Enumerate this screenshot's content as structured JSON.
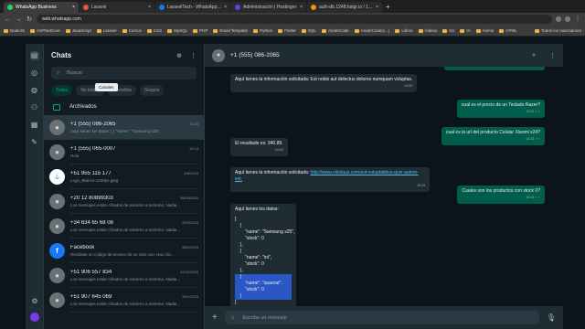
{
  "browser": {
    "tabs": [
      {
        "label": "WhatsApp Business",
        "active": true,
        "color": "#25d366"
      },
      {
        "label": "Laravel",
        "active": false,
        "color": "#f05340"
      },
      {
        "label": "LaravelTech - WhatsApp - Meta",
        "active": false,
        "color": "#1877f2"
      },
      {
        "label": "Administración | Hostinger",
        "active": false,
        "color": "#673de6"
      },
      {
        "label": "auth-db.1248.hstgr.io / 127.0.0",
        "active": false,
        "color": "#f29111"
      }
    ],
    "new_tab": "+",
    "url": "web.whatsapp.com",
    "bookmarks": [
      "NodeJS",
      "ASPNetCore",
      "JavaScript",
      "Laravel",
      "Cursos",
      "CSS",
      "MySQL",
      "PHP",
      "Email Template",
      "Python",
      "Flutter",
      "SQL",
      "AnderCode",
      "AnderCode(c...)",
      "Libros",
      "Videos",
      "Go",
      "IA",
      "Anime",
      "HTML"
    ],
    "all_bookmarks": "Todos los marcadores"
  },
  "chatlist": {
    "title": "Chats",
    "search_placeholder": "Buscar",
    "filters": [
      "Todos",
      "No leídos",
      "Favoritos",
      "Grupos"
    ],
    "tooltip": "Canales",
    "archived_label": "Archivados",
    "chats": [
      {
        "name": "+1 (555) 086-2065",
        "time": "10:24",
        "preview": "Aquí tienes los datos: [ { \"name\": \"Samsung s25\",",
        "active": true,
        "avatar": "person"
      },
      {
        "name": "+1 (555) 065-0007",
        "time": "10:14",
        "preview": "Hola",
        "active": false,
        "avatar": "person"
      },
      {
        "name": "+51 955 115 177",
        "time": "4/6/2024",
        "preview": "Logo_Blanco-1200px.jpeg",
        "active": false,
        "avatar": "logo"
      },
      {
        "name": "+20 12 80899303",
        "time": "06/16/2024",
        "preview": "Los mensajes están cifrados de extremo a extremo. Nadie...",
        "active": false,
        "avatar": "person"
      },
      {
        "name": "+34 634 65 68 08",
        "time": "20/2/2023",
        "preview": "Los mensajes están cifrados de extremo a extremo. Nadie...",
        "active": false,
        "avatar": "person"
      },
      {
        "name": "Facebook",
        "time": "28/2/2023",
        "preview": "Recibiste un código de acceso de un solo uso. Haz clic...",
        "active": false,
        "avatar": "facebook"
      },
      {
        "name": "+51 906 557 834",
        "time": "22/11/2024",
        "preview": "Los mensajes están cifrados de extremo a extremo. Nadie...",
        "active": false,
        "avatar": "person"
      },
      {
        "name": "+51 907 645 069",
        "time": "20/1/2023",
        "preview": "Los mensajes están cifrados de extremo a extremo. Nadie...",
        "active": false,
        "avatar": "person"
      }
    ]
  },
  "conversation": {
    "contact": "+1 (555) 086-2065",
    "composer_placeholder": "Escribe un mensaje",
    "messages": [
      {
        "dir": "in",
        "text": "Aquí tienes la información solicitada: Est nobis aut delectus dolores numquam voluptas.",
        "time": "10:22"
      },
      {
        "dir": "out",
        "text": "cual es el precio de un Teclado Razer?",
        "time": "10:23 ✓✓"
      },
      {
        "dir": "out",
        "text": "cual es la url del producto Celular Xiaomi s24?",
        "time": "10:23 ✓✓"
      },
      {
        "dir": "in",
        "text": "El resultado es: 340.89.",
        "time": "10:23"
      },
      {
        "dir": "in",
        "text": "Aquí tienes la información solicitada:",
        "link": "http://www.nikolaus.com/est-voluptatibus-quis-autem-est.",
        "time": "10:23"
      },
      {
        "dir": "out",
        "text": "Cuales son los productos con stock 0?",
        "time": "10:23 ✓✓"
      },
      {
        "dir": "in",
        "text": "Aquí tienes los datos:",
        "time": "10:24"
      }
    ],
    "code_lines": [
      "[",
      "    {",
      "        \"name\": \"Samsung s25\",",
      "        \"stock\": 0",
      "    },",
      "    {",
      "        \"name\": \"int\",",
      "        \"stock\": 0",
      "    },",
      "    {",
      "        \"name\": \"quaerat\",",
      "        \"stock\": 0",
      "    }",
      "]"
    ]
  }
}
